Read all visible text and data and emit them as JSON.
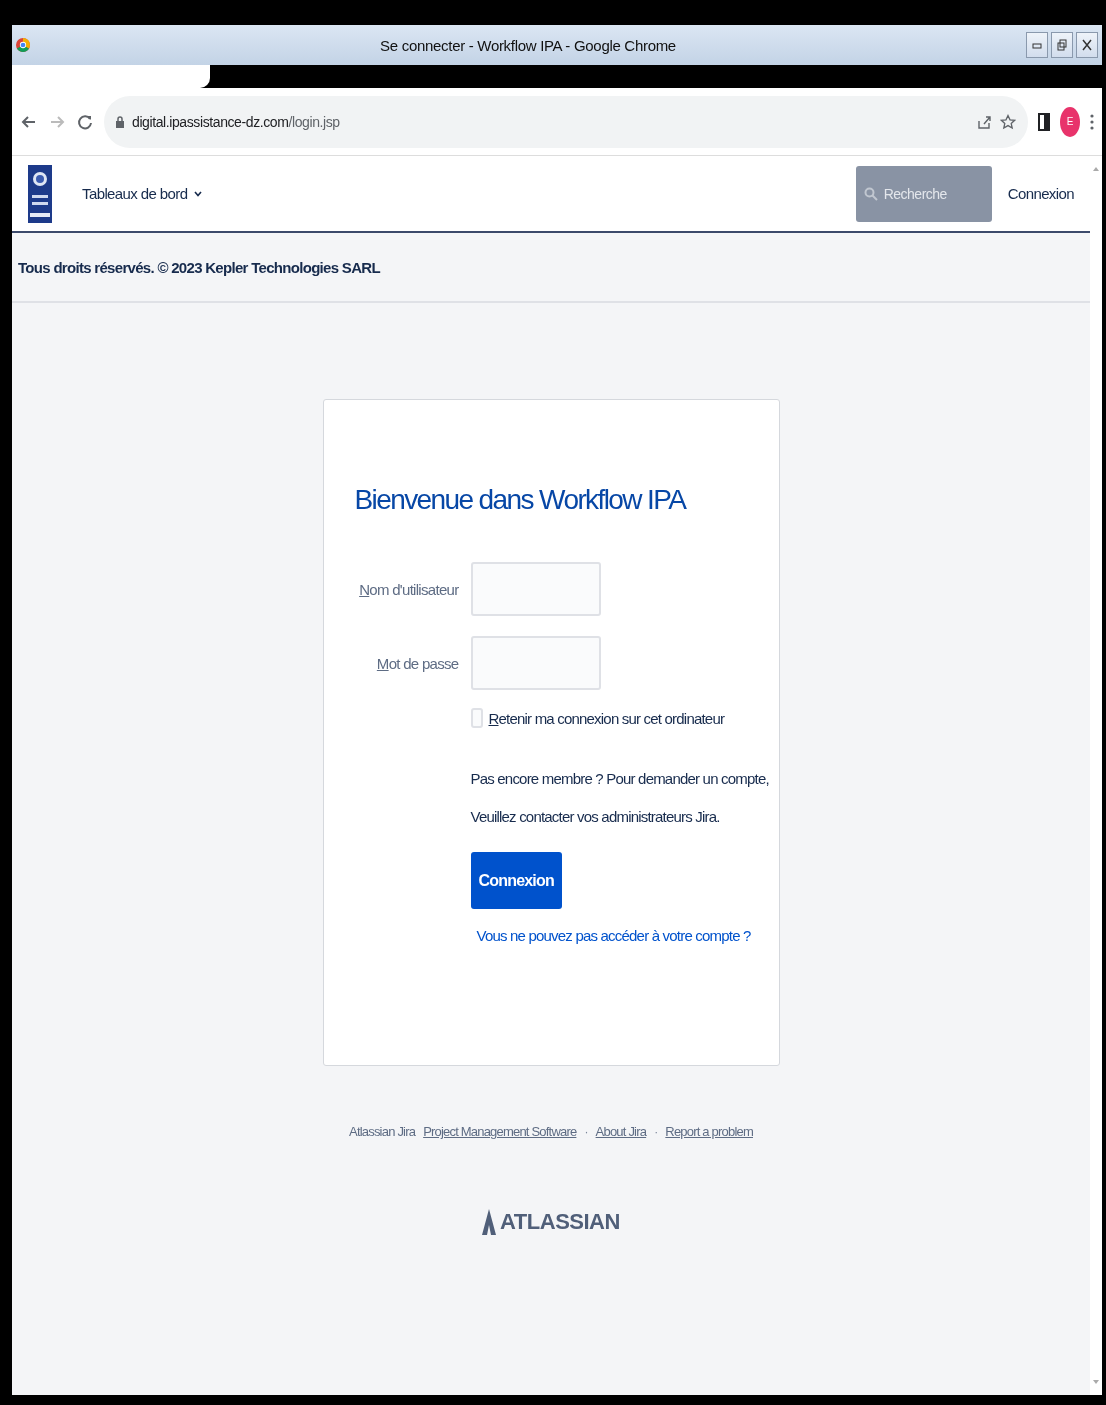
{
  "window": {
    "title": "Se connecter - Workflow IPA - Google Chrome"
  },
  "browser": {
    "url_host": "digital.ipassistance-dz.com",
    "url_path": "/login.jsp",
    "profile_initial": "E"
  },
  "header": {
    "nav": [
      {
        "label": "Tableaux de bord"
      }
    ],
    "search": {
      "placeholder": "Recherche"
    },
    "login_link": "Connexion"
  },
  "notice": "Tous droits réservés. © 2023 Kepler Technologies SARL",
  "login": {
    "title": "Bienvenue dans Workflow IPA",
    "fields": [
      {
        "label": "Nom d'utilisateur"
      },
      {
        "label": "Mot de passe"
      }
    ],
    "remember": {
      "label": "Retenir ma connexion sur cet ordinateur",
      "checked": false
    },
    "signup_lines": [
      "Pas encore membre ? Pour demander un compte,",
      "Veuillez contacter vos administrateurs Jira."
    ],
    "submit": "Connexion",
    "forgot": "Vous ne pouvez pas accéder à votre compte ?"
  },
  "footer": {
    "prefix": "Atlassian Jira",
    "links": [
      "Project Management Software",
      "About Jira",
      "Report a problem"
    ],
    "separator": "·",
    "brand": "ATLASSIAN"
  }
}
